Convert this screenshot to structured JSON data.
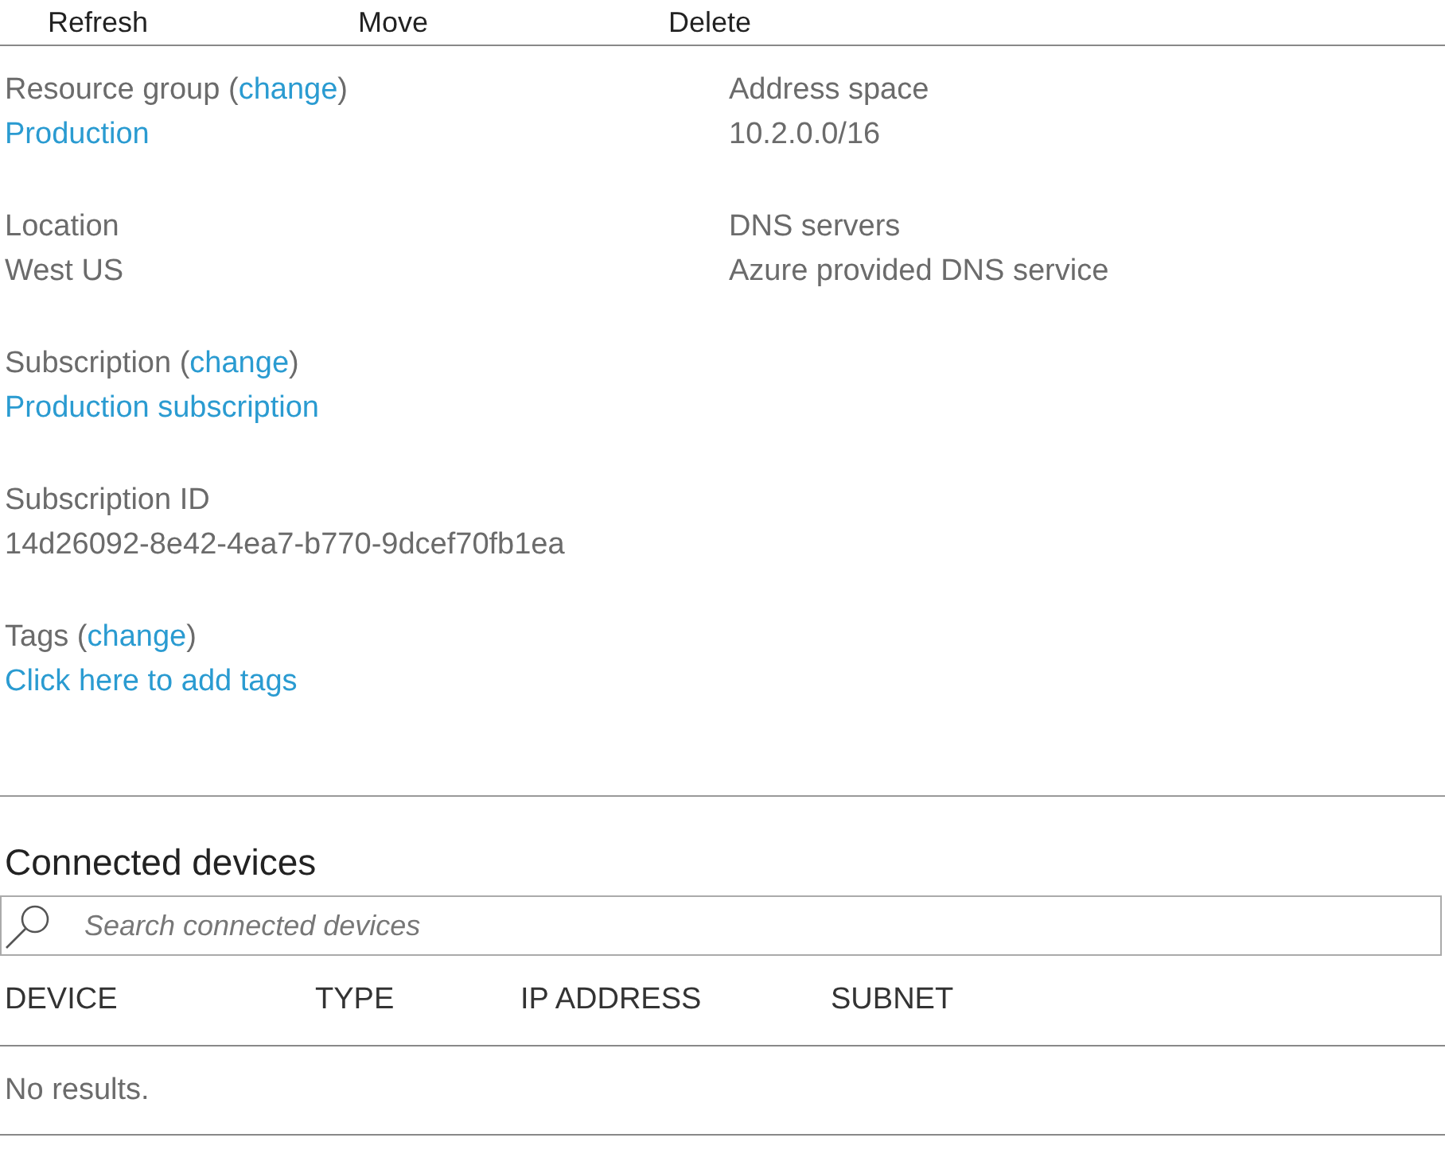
{
  "toolbar": [
    {
      "label": "Refresh"
    },
    {
      "label": "Move"
    },
    {
      "label": "Delete"
    }
  ],
  "essentials": {
    "left": [
      {
        "label": "Resource group",
        "open": "(",
        "change": "change",
        "close": ")",
        "value": "Production",
        "link": true
      },
      {
        "label": "Location",
        "value": "West US",
        "link": false
      },
      {
        "label": "Subscription",
        "open": "(",
        "change": "change",
        "close": ")",
        "value": "Production subscription",
        "link": true
      },
      {
        "label": "Subscription ID",
        "value": "14d26092-8e42-4ea7-b770-9dcef70fb1ea",
        "link": false
      },
      {
        "label": "Tags",
        "open": "(",
        "change": "change",
        "close": ")",
        "value": "Click here to add tags",
        "link": true
      }
    ],
    "right": [
      {
        "label": "Address space",
        "value": "10.2.0.0/16",
        "link": false
      },
      {
        "label": "DNS servers",
        "value": "Azure provided DNS service",
        "link": false
      }
    ]
  },
  "connected_devices": {
    "title": "Connected devices",
    "search": {
      "placeholder": "Search connected devices"
    },
    "columns": [
      "DEVICE",
      "TYPE",
      "IP ADDRESS",
      "SUBNET"
    ],
    "empty_text": "No results."
  }
}
